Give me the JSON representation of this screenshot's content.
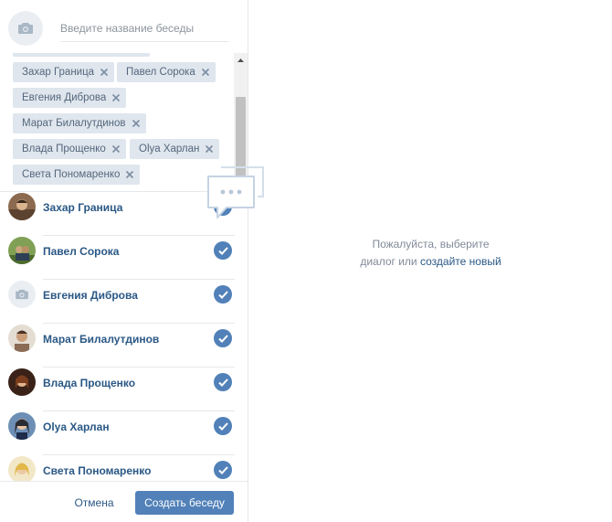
{
  "header": {
    "chat_name_placeholder": "Введите название беседы",
    "photo_icon": "camera-icon"
  },
  "selected_tokens": [
    {
      "label": "Захар Граница"
    },
    {
      "label": "Павел Сорока"
    },
    {
      "label": "Евгения Диброва"
    },
    {
      "label": "Марат Билалутдинов"
    },
    {
      "label": "Влада Прощенко"
    },
    {
      "label": "Olya Харлан"
    },
    {
      "label": "Света Пономаренко"
    }
  ],
  "friends": [
    {
      "name": "Захар Граница",
      "checked": true,
      "avatar": "photo-brown"
    },
    {
      "name": "Павел Сорока",
      "checked": true,
      "avatar": "photo-green"
    },
    {
      "name": "Евгения Диброва",
      "checked": true,
      "avatar": "placeholder-camera"
    },
    {
      "name": "Марат Билалутдинов",
      "checked": true,
      "avatar": "photo-light"
    },
    {
      "name": "Влада Прощенко",
      "checked": true,
      "avatar": "photo-dark"
    },
    {
      "name": "Olya Харлан",
      "checked": true,
      "avatar": "photo-blue"
    },
    {
      "name": "Света Пономаренко",
      "checked": true,
      "avatar": "photo-yellow"
    }
  ],
  "footer": {
    "cancel_label": "Отмена",
    "create_label": "Создать беседу"
  },
  "empty_state": {
    "line1": "Пожалуйста, выберите",
    "line2_prefix": "диалог или",
    "create_link": "создайте новый",
    "icon": "message-bubble-icon"
  },
  "colors": {
    "accent": "#5181b8",
    "link": "#2a5885",
    "token_bg": "#dfe6ed",
    "token_text": "#55677d",
    "muted_text": "#828a99",
    "border": "#e7e8ec"
  }
}
